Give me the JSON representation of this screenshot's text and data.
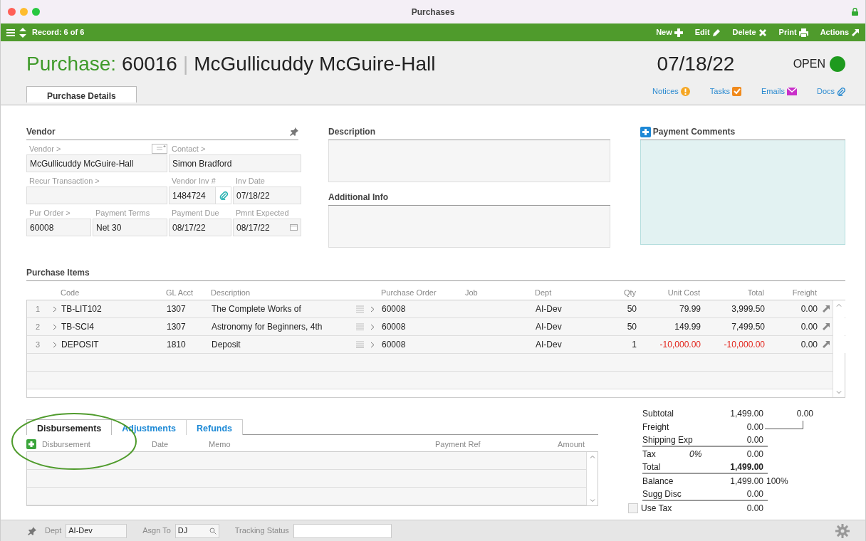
{
  "window": {
    "title": "Purchases"
  },
  "toolbar": {
    "record": "Record: 6 of 6",
    "actions": [
      {
        "label": "New",
        "kind": "plus"
      },
      {
        "label": "Edit",
        "kind": "pencil"
      },
      {
        "label": "Delete",
        "kind": "cross"
      },
      {
        "label": "Print",
        "kind": "printer"
      },
      {
        "label": "Actions",
        "kind": "arrow"
      }
    ]
  },
  "header": {
    "prefix": "Purchase:",
    "number": "60016",
    "separator": "|",
    "vendor": "McGullicuddy McGuire-Hall",
    "date": "07/18/22",
    "status": "OPEN"
  },
  "tabs": [
    {
      "label": "Purchase Details",
      "selected": true
    }
  ],
  "links": [
    {
      "label": "Notices",
      "kind": "alert"
    },
    {
      "label": "Tasks",
      "kind": "task"
    },
    {
      "label": "Emails",
      "kind": "mail"
    },
    {
      "label": "Docs",
      "kind": "clip"
    }
  ],
  "vendor_section": {
    "title": "Vendor",
    "fields": [
      {
        "label": "Vendor >",
        "value": "McGullicuddy McGuire-Hall",
        "kind": "note"
      },
      {
        "label": "Contact >",
        "value": "Simon Bradford",
        "kind": "plain"
      },
      {
        "label": "Recur Transaction >",
        "kind": "plain"
      },
      {
        "label": "Vendor Inv #",
        "value": "1484724",
        "kind": "attach"
      },
      {
        "label": "Inv Date",
        "value": "07/18/22",
        "kind": "plain"
      },
      {
        "label": "Pur Order >",
        "value": "60008",
        "kind": "plain"
      },
      {
        "label": "Payment Terms",
        "value": "Net 30",
        "kind": "plain"
      },
      {
        "label": "Payment Due",
        "value": "08/17/22",
        "kind": "plain"
      },
      {
        "label": "Pmnt Expected",
        "value": "08/17/22",
        "kind": "date"
      }
    ]
  },
  "notes": [
    {
      "title": "Description"
    },
    {
      "title": "Additional Info"
    }
  ],
  "payment_comments": {
    "title": "Payment Comments"
  },
  "purchase_items": {
    "title": "Purchase Items",
    "columns": [
      "Code",
      "GL Acct",
      "Description",
      "Purchase Order",
      "Job",
      "Dept",
      "Qty",
      "Unit Cost",
      "Total",
      "Freight"
    ],
    "rows": [
      {
        "line": "1",
        "code": "TB-LIT102",
        "gl_acct": "1307",
        "description": "The Complete Works of",
        "purchase_order": "60008",
        "dept": "AI-Dev",
        "qty": "50",
        "unit_cost": "79.99",
        "total": "3,999.50",
        "freight": "0.00",
        "negative": false
      },
      {
        "line": "2",
        "code": "TB-SCI4",
        "gl_acct": "1307",
        "description": "Astronomy for Beginners, 4th",
        "purchase_order": "60008",
        "dept": "AI-Dev",
        "qty": "50",
        "unit_cost": "149.99",
        "total": "7,499.50",
        "freight": "0.00",
        "negative": false
      },
      {
        "line": "3",
        "code": "DEPOSIT",
        "gl_acct": "1810",
        "description": "Deposit",
        "purchase_order": "60008",
        "dept": "AI-Dev",
        "qty": "1",
        "unit_cost": "-10,000.00",
        "total": "-10,000.00",
        "freight": "0.00",
        "negative": true
      }
    ]
  },
  "lower_tabs": [
    {
      "label": "Disbursements",
      "selected": true
    },
    {
      "label": "Adjustments",
      "selected": false
    },
    {
      "label": "Refunds",
      "selected": false
    }
  ],
  "disbursements": {
    "columns": [
      "Disbursement",
      "Date",
      "Memo",
      "Payment Ref",
      "Amount"
    ]
  },
  "totals": [
    {
      "label": "Subtotal",
      "value": "1,499.00",
      "note": "0.00",
      "kind": "plain"
    },
    {
      "label": "Freight",
      "value": "0.00",
      "kind": "linked"
    },
    {
      "label": "Shipping Exp",
      "value": "0.00",
      "kind": "plain",
      "rule_after": true
    },
    {
      "label": "Tax",
      "rate": "0%",
      "value": "0.00",
      "kind": "plain"
    },
    {
      "label": "Total",
      "value": "1,499.00",
      "kind": "grand",
      "rule_after": true
    },
    {
      "label": "Balance",
      "value": "1,499.00",
      "note": "100%",
      "kind": "plain"
    },
    {
      "label": "Sugg Disc",
      "value": "0.00",
      "kind": "plain",
      "rule_after": true
    },
    {
      "label": "Use Tax",
      "value": "0.00",
      "kind": "check",
      "checked": false
    }
  ],
  "footer": {
    "fields": [
      {
        "label": "Dept",
        "value": "AI-Dev",
        "kind": "plain"
      },
      {
        "label": "Asgn To",
        "value": "DJ",
        "kind": "search"
      },
      {
        "label": "Tracking Status",
        "kind": "wide"
      }
    ]
  }
}
